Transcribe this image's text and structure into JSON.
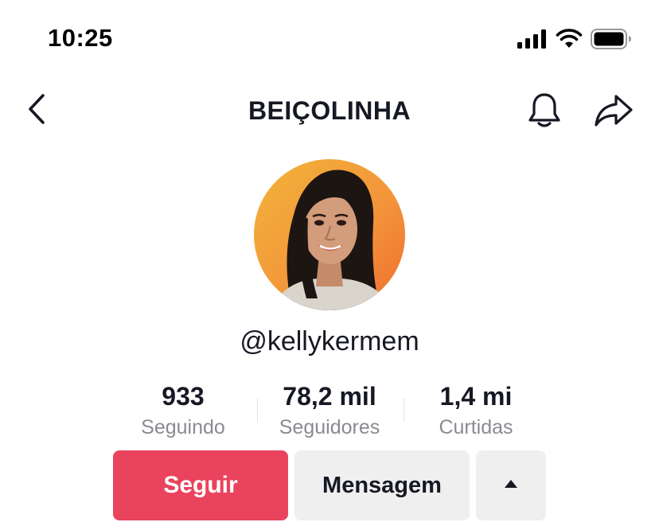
{
  "status_bar": {
    "time": "10:25",
    "icons": [
      "cellular-signal-icon",
      "wifi-icon",
      "battery-icon"
    ]
  },
  "nav": {
    "title": "BEIÇOLINHA",
    "back_icon": "chevron-left-icon",
    "bell_icon": "bell-icon",
    "share_icon": "share-arrow-icon"
  },
  "profile": {
    "username": "@kellykermem",
    "stats": [
      {
        "value": "933",
        "label": "Seguindo"
      },
      {
        "value": "78,2 mil",
        "label": "Seguidores"
      },
      {
        "value": "1,4 mi",
        "label": "Curtidas"
      }
    ]
  },
  "actions": {
    "follow_label": "Seguir",
    "message_label": "Mensagem",
    "more_icon": "triangle-up-icon"
  },
  "colors": {
    "accent": "#ea435e",
    "button_secondary": "#efefef",
    "text_primary": "#161823",
    "text_secondary": "#8a8b91"
  }
}
